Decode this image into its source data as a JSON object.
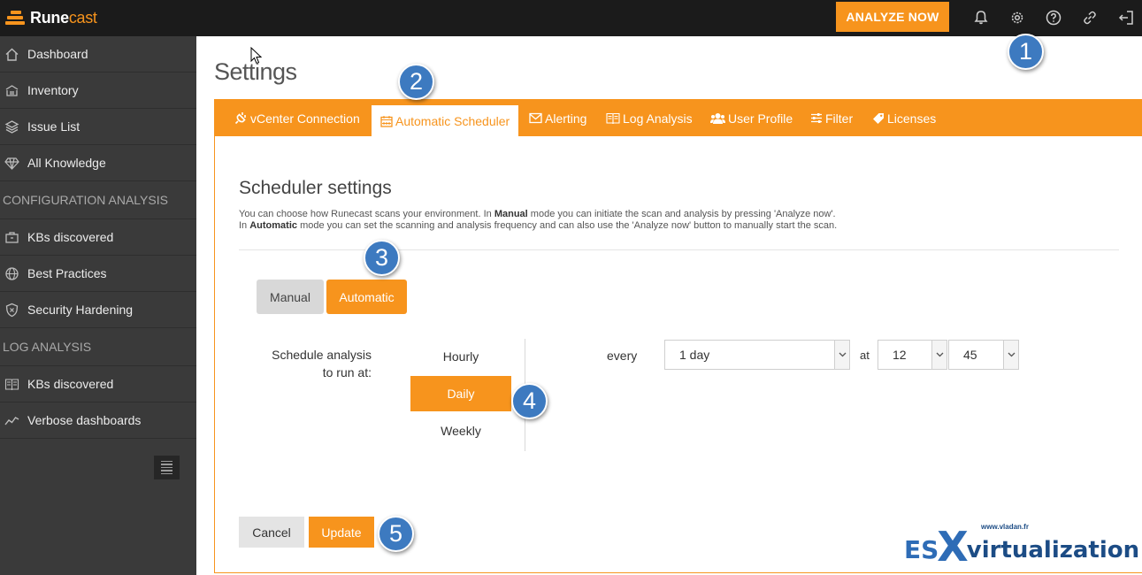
{
  "app": {
    "logo_text": "Rune",
    "logo_accent": "cast",
    "analyze_label": "ANALYZE NOW"
  },
  "sidebar": {
    "items": [
      {
        "label": "Dashboard",
        "icon": "home-icon"
      },
      {
        "label": "Inventory",
        "icon": "inventory-icon"
      },
      {
        "label": "Issue List",
        "icon": "layers-icon"
      },
      {
        "label": "All Knowledge",
        "icon": "diamond-icon"
      }
    ],
    "section_config": "CONFIGURATION ANALYSIS",
    "config_items": [
      {
        "label": "KBs discovered",
        "icon": "briefcase-icon"
      },
      {
        "label": "Best Practices",
        "icon": "globe-icon"
      },
      {
        "label": "Security Hardening",
        "icon": "shield-icon"
      }
    ],
    "section_log": "LOG ANALYSIS",
    "log_items": [
      {
        "label": "KBs discovered",
        "icon": "book-icon"
      },
      {
        "label": "Verbose dashboards",
        "icon": "trend-icon"
      }
    ]
  },
  "page": {
    "title": "Settings"
  },
  "tabs": [
    {
      "label": "vCenter Connection",
      "icon": "plug-icon"
    },
    {
      "label": "Automatic Scheduler",
      "icon": "calendar-icon",
      "active": true
    },
    {
      "label": "Alerting",
      "icon": "envelope-icon"
    },
    {
      "label": "Log Analysis",
      "icon": "book-icon"
    },
    {
      "label": "User Profile",
      "icon": "users-icon"
    },
    {
      "label": "Filter",
      "icon": "sliders-icon"
    },
    {
      "label": "Licenses",
      "icon": "tag-icon"
    }
  ],
  "scheduler": {
    "title": "Scheduler settings",
    "desc_1a": "You can choose how Runecast scans your environment. In ",
    "desc_1b": "Manual",
    "desc_1c": " mode you can initiate the scan and analysis by pressing 'Analyze now'.",
    "desc_2a": "In ",
    "desc_2b": "Automatic",
    "desc_2c": " mode you can set the scanning and analysis frequency and can also use the 'Analyze now' button to manually start the scan.",
    "mode_manual": "Manual",
    "mode_automatic": "Automatic",
    "selected_mode": "Automatic",
    "schedule_label": "Schedule analysis to run at:",
    "frequency_options": [
      "Hourly",
      "Daily",
      "Weekly"
    ],
    "selected_frequency": "Daily",
    "every_label": "every",
    "interval_value": "1 day",
    "at_label": "at",
    "hour_value": "12",
    "minute_value": "45",
    "cancel_label": "Cancel",
    "update_label": "Update"
  },
  "callouts": [
    "1",
    "2",
    "3",
    "4",
    "5"
  ],
  "watermark": {
    "url": "www.vladan.fr",
    "es": "ES",
    "x": "X",
    "virt": "virtualization"
  },
  "colors": {
    "accent": "#f7941d",
    "topbar": "#1b1b1b",
    "sidebar": "#3a3a3a",
    "callout": "#3d7ac0"
  }
}
